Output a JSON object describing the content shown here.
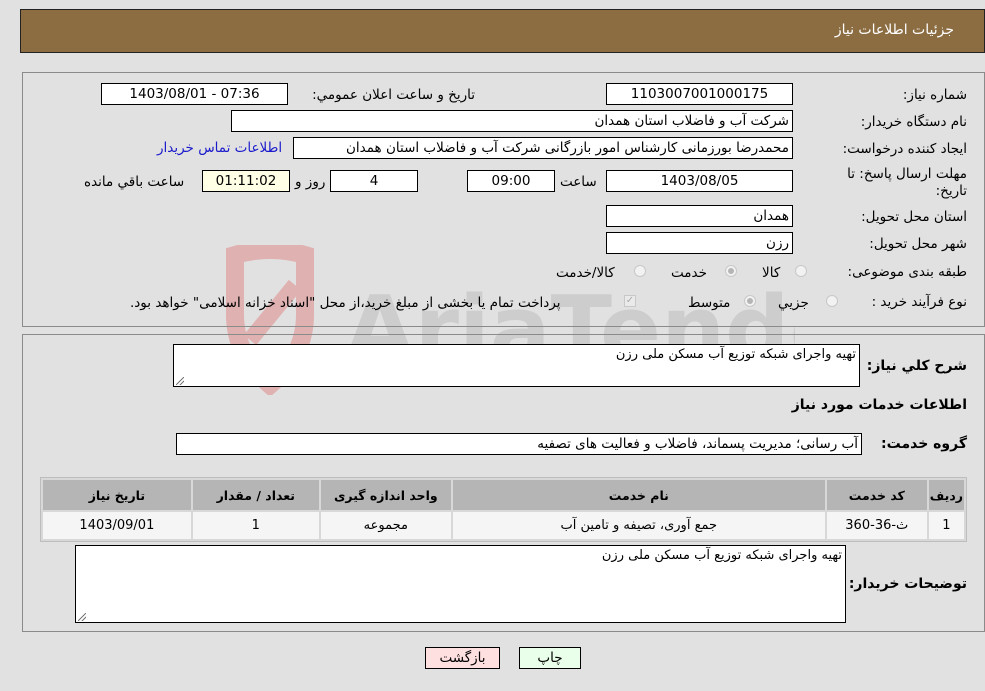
{
  "header": {
    "title": "جزئیات اطلاعات نیاز"
  },
  "form": {
    "need_number_label": "شماره نیاز:",
    "need_number": "1103007001000175",
    "announce_label": "تاریخ و ساعت اعلان عمومي:",
    "announce_value": "1403/08/01 - 07:36",
    "buyer_org_label": "نام دستگاه خریدار:",
    "buyer_org": "شرکت آب و فاضلاب استان همدان",
    "creator_label": "ایجاد کننده درخواست:",
    "creator": "محمدرضا بورزمانی کارشناس امور بازرگانی شرکت آب و فاضلاب استان همدان",
    "contact_link": "اطلاعات تماس خریدار",
    "deadline_label_1": "مهلت ارسال پاسخ: تا",
    "deadline_label_2": "تاریخ:",
    "deadline_date": "1403/08/05",
    "time_label": "ساعت",
    "deadline_time": "09:00",
    "days_value": "4",
    "days_label": "روز و",
    "remaining_value": "01:11:02",
    "remaining_label": "ساعت باقي مانده",
    "province_label": "استان محل تحویل:",
    "province": "همدان",
    "city_label": "شهر محل تحویل:",
    "city": "رزن",
    "category_label": "طبقه بندی موضوعی:",
    "category_options": [
      {
        "label": "کالا",
        "selected": false
      },
      {
        "label": "خدمت",
        "selected": true
      },
      {
        "label": "کالا/خدمت",
        "selected": false
      }
    ],
    "process_label": "نوع فرآیند خرید :",
    "process_options": [
      {
        "label": "جزيي",
        "selected": false
      },
      {
        "label": "متوسط",
        "selected": true
      }
    ],
    "treasury_note": "پرداخت تمام یا بخشی از مبلغ خرید،از محل \"اسناد خزانه اسلامی\" خواهد بود.",
    "treasury_checked": true
  },
  "details": {
    "summary_label": "شرح كلي نیاز:",
    "summary": "تهیه واجرای شبکه توزیع آب مسکن ملی رزن",
    "services_heading": "اطلاعات خدمات مورد نیاز",
    "service_group_label": "گروه خدمت:",
    "service_group": "آب رسانی؛ مدیریت پسماند، فاضلاب و فعالیت های تصفیه",
    "table": {
      "headers": [
        "ردیف",
        "کد خدمت",
        "نام خدمت",
        "واحد اندازه گیری",
        "تعداد / مقدار",
        "تاریخ نیاز"
      ],
      "rows": [
        [
          "1",
          "ث-36-360",
          "جمع آوری، تصیفه و تامین آب",
          "مجموعه",
          "1",
          "1403/09/01"
        ]
      ]
    },
    "buyer_notes_label": "توضیحات خریدار:",
    "buyer_notes": "تهیه واجرای شبکه توزیع آب مسکن ملی رزن"
  },
  "buttons": {
    "print": "چاپ",
    "back": "بازگشت"
  },
  "colors": {
    "header_bg": "#8c6d42",
    "print_bg": "#eaffea",
    "back_bg": "#ffe0e0",
    "link": "#1a1acc"
  }
}
